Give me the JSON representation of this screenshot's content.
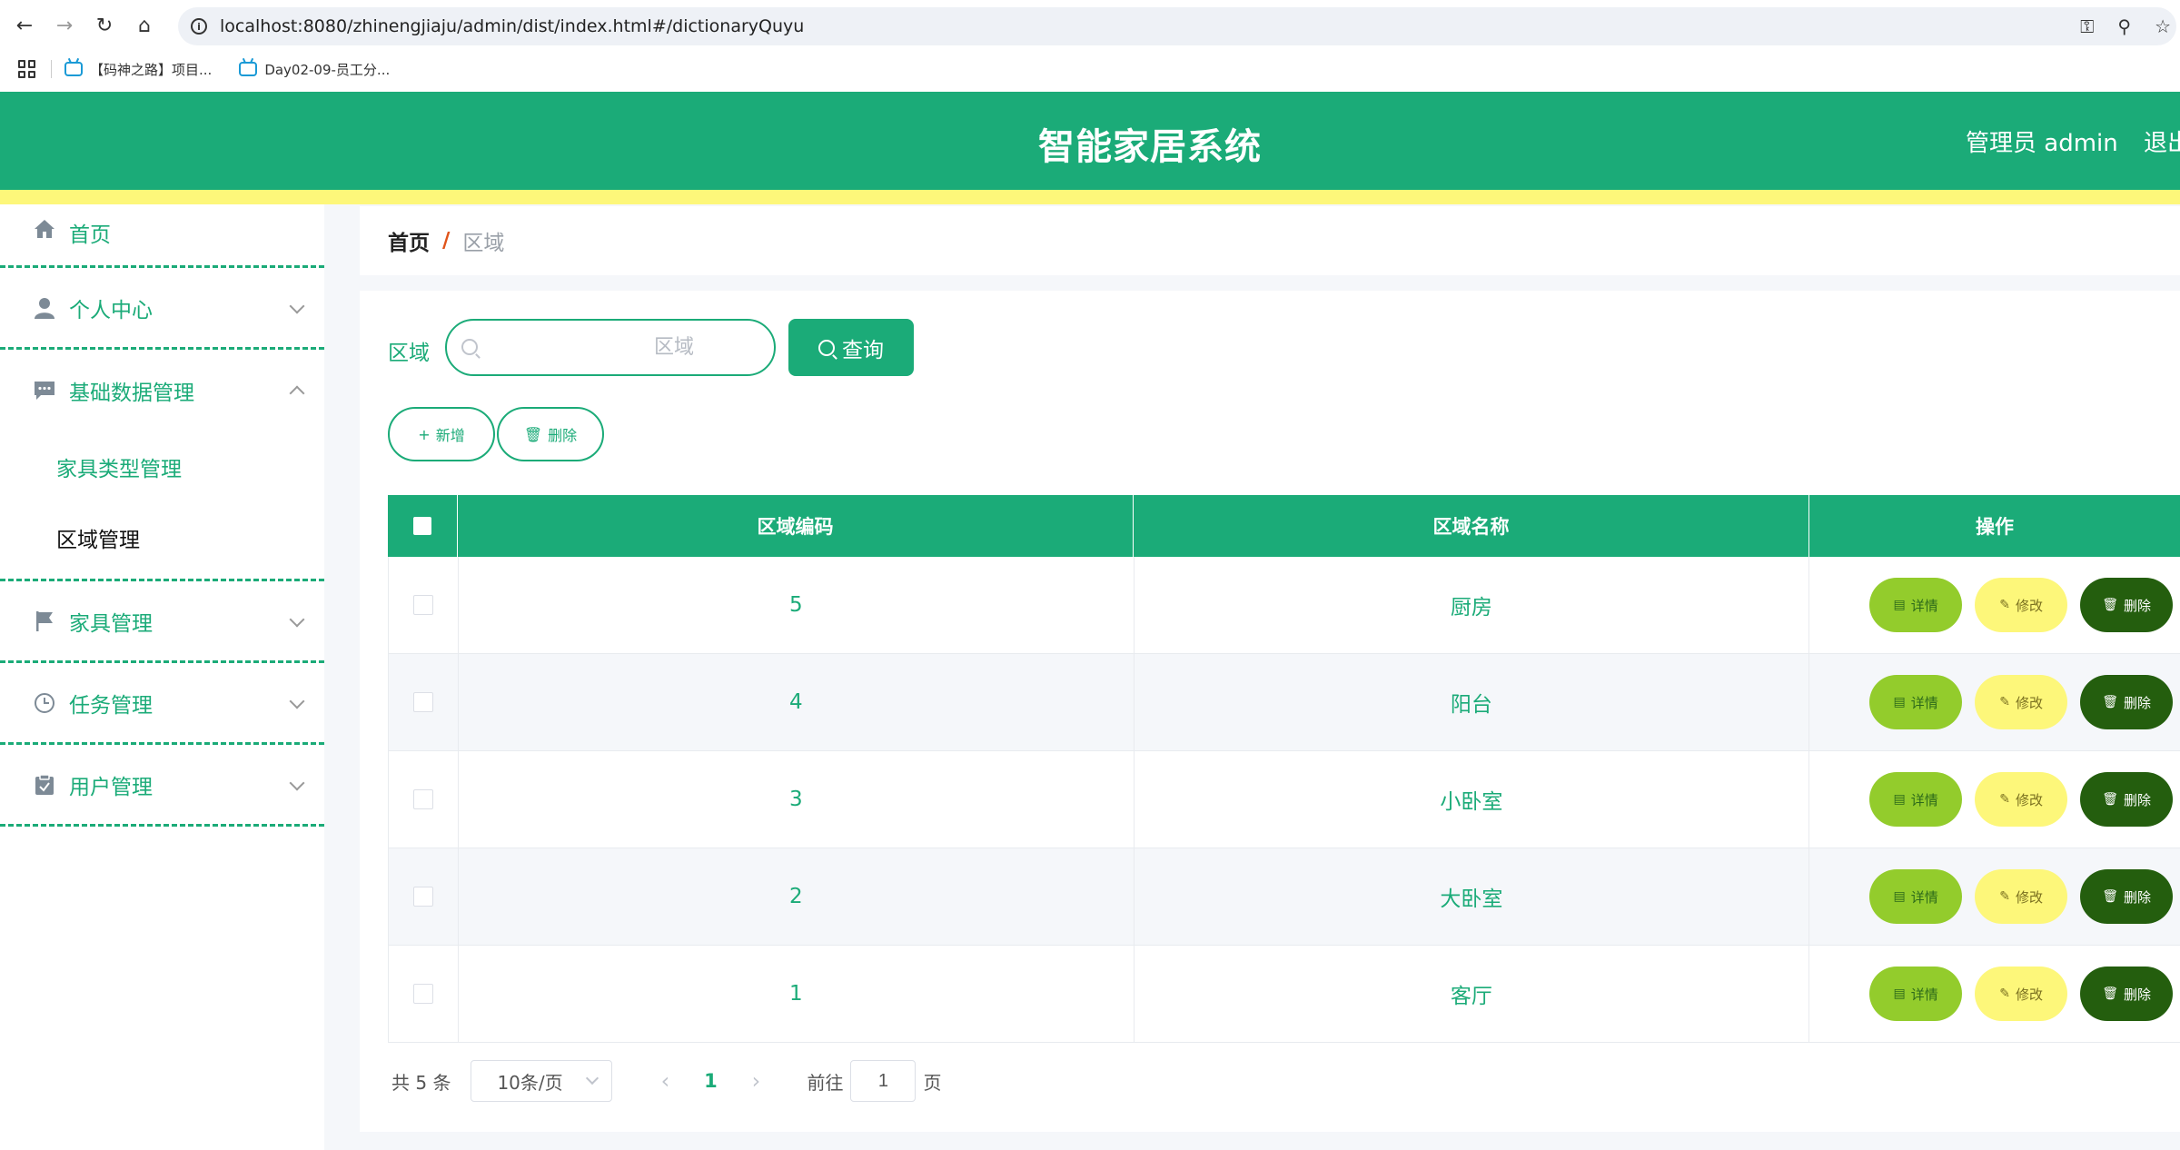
{
  "browser": {
    "url": "localhost:8080/zhinengjiaju/admin/dist/index.html#/dictionaryQuyu",
    "bookmarks": [
      {
        "label": "【码神之路】项目..."
      },
      {
        "label": "Day02-09-员工分..."
      }
    ]
  },
  "header": {
    "title": "智能家居系统",
    "user": "管理员 admin",
    "logout": "退出",
    "colors": {
      "primary": "#1bab78",
      "accent_bar": "#fdf77a"
    }
  },
  "sidebar": {
    "items": [
      {
        "label": "首页",
        "icon": "home-icon"
      },
      {
        "label": "个人中心",
        "icon": "user-icon"
      },
      {
        "label": "基础数据管理",
        "icon": "chat-icon",
        "children": [
          "家具类型管理",
          "区域管理"
        ]
      },
      {
        "label": "家具管理",
        "icon": "flag-icon"
      },
      {
        "label": "任务管理",
        "icon": "clock-icon"
      },
      {
        "label": "用户管理",
        "icon": "clipboard-icon"
      }
    ]
  },
  "breadcrumb": {
    "home": "首页",
    "separator": "/",
    "current": "区域"
  },
  "search": {
    "label": "区域",
    "placeholder": "区域",
    "button": "查询"
  },
  "actions": {
    "add": "新增",
    "delete": "删除"
  },
  "table": {
    "headers": [
      "区域编码",
      "区域名称",
      "操作"
    ],
    "rows": [
      {
        "code": "5",
        "name": "厨房"
      },
      {
        "code": "4",
        "name": "阳台"
      },
      {
        "code": "3",
        "name": "小卧室"
      },
      {
        "code": "2",
        "name": "大卧室"
      },
      {
        "code": "1",
        "name": "客厅"
      }
    ],
    "row_actions": {
      "detail": "详情",
      "edit": "修改",
      "delete": "删除"
    }
  },
  "pagination": {
    "total": "共 5 条",
    "page_size": "10条/页",
    "current_page": "1",
    "goto_label": "前往",
    "goto_value": "1",
    "page_suffix": "页"
  }
}
